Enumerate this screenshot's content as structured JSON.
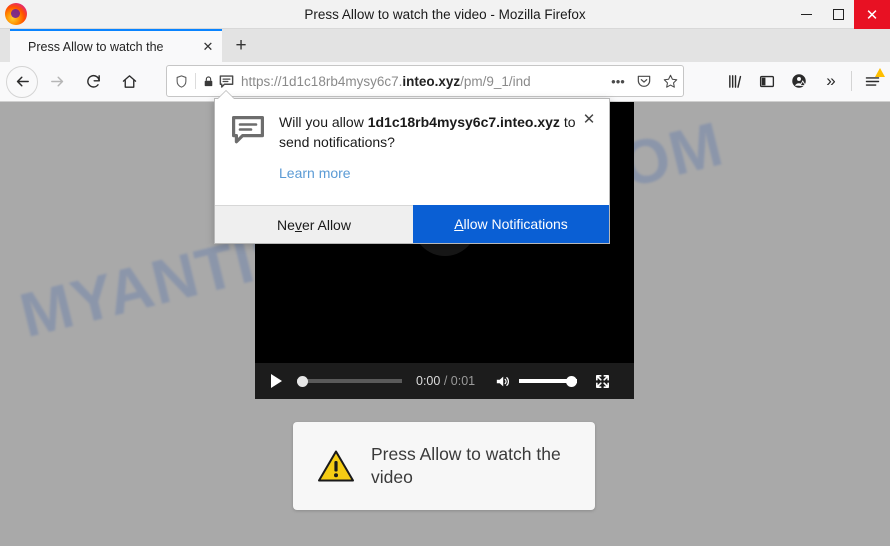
{
  "window": {
    "title": "Press Allow to watch the video - Mozilla Firefox",
    "minimize_label": "—",
    "maximize_label": "□",
    "close_label": "✕"
  },
  "tabs": {
    "active": {
      "title": "Press Allow to watch the",
      "close_label": "✕"
    },
    "new_tab_label": "+"
  },
  "nav": {
    "back_label": "←",
    "forward_label": "→",
    "reload_label": "↻",
    "home_label": "⌂"
  },
  "urlbar": {
    "scheme": "https://",
    "subdomain": "1d1c18rb4mysy6c7.",
    "domain": "inteo.xyz",
    "path": "/pm/9_1/ind",
    "full_url": "https://1d1c18rb4mysy6c7.inteo.xyz/pm/9_1/ind",
    "page_actions_label": "•••",
    "pocket_label": "save-to-pocket",
    "bookmark_label": "☆"
  },
  "toolbar_right": {
    "library_label": "library",
    "sidebar_label": "sidebar",
    "account_label": "account",
    "overflow_label": "»",
    "menu_label": "menu"
  },
  "notification": {
    "message_line1": "Will you allow",
    "origin": "1d1c18rb4mysy6c7.inteo.xyz",
    "message_line2": " to send notifications?",
    "learn_more": "Learn more",
    "close_label": "✕",
    "never_allow_pre": "Ne",
    "never_allow_acc": "v",
    "never_allow_post": "er Allow",
    "allow_acc": "A",
    "allow_post": "llow Notifications",
    "accent_color": "#0a5fd4"
  },
  "video": {
    "play_label": "play",
    "current_time": "0:00",
    "separator": "/",
    "duration": "0:01",
    "volume_label": "volume",
    "fullscreen_label": "fullscreen",
    "progress_percent": 0,
    "volume_percent": 100
  },
  "alert": {
    "icon": "warning-triangle-icon",
    "text": "Press Allow to watch the video",
    "icon_color": "#f5cc14"
  },
  "page": {
    "watermark": "MYANTISPYWARE.COM",
    "background_color": "#a9a9a9"
  }
}
